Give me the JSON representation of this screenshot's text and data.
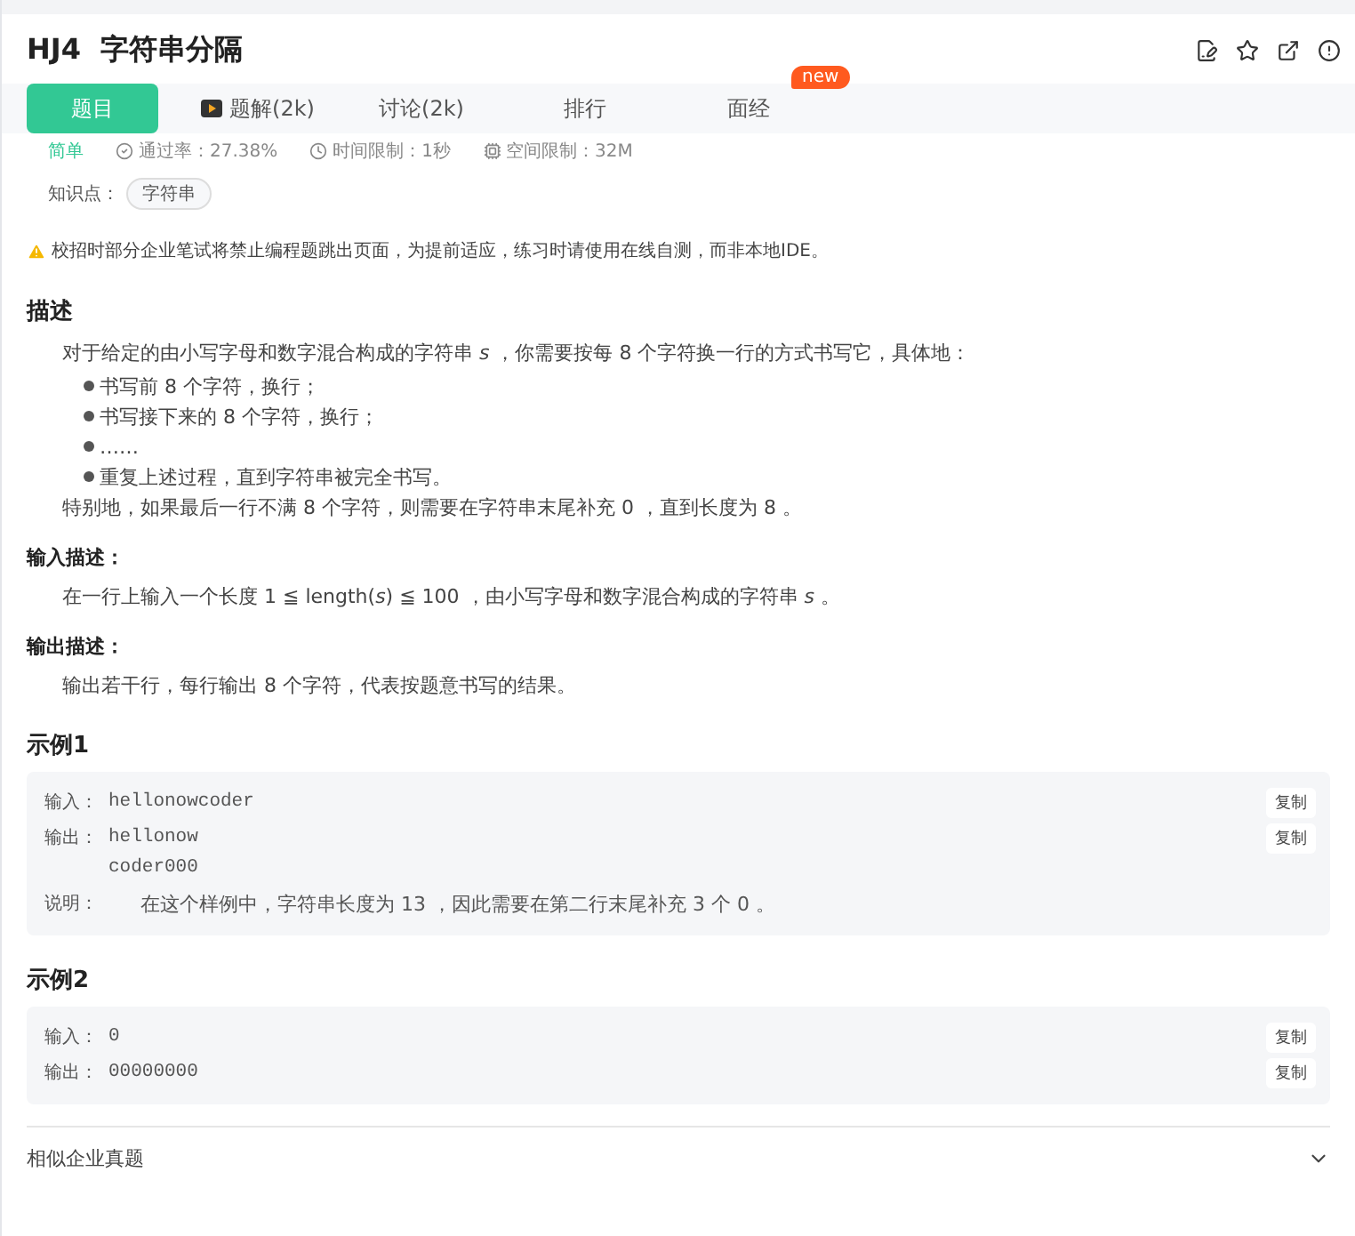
{
  "title": "HJ4  字符串分隔",
  "tabs": [
    {
      "label": "题目",
      "selected": true,
      "kind": "plain"
    },
    {
      "label": "题解(2k)",
      "selected": false,
      "kind": "video"
    },
    {
      "label": "讨论(2k)",
      "selected": false,
      "kind": "plain"
    },
    {
      "label": "排行",
      "selected": false,
      "kind": "plain"
    },
    {
      "label": "面经",
      "selected": false,
      "kind": "plain",
      "badge": "new"
    }
  ],
  "stats": {
    "difficulty": "简单",
    "pass_rate": "通过率：27.38%",
    "time_limit": "时间限制：1秒",
    "memory_limit": "空间限制：32M"
  },
  "knowledge": {
    "label": "知识点：",
    "tags": [
      "字符串"
    ]
  },
  "notice": "校招时部分企业笔试将禁止编程题跳出页面，为提前适应，练习时请使用在线自测，而非本地IDE。",
  "description": {
    "heading": "描述",
    "intro": "对于给定的由小写字母和数字混合构成的字符串 *s* ，你需要按每 8 个字符换一行的方式书写它，具体地：",
    "bullets": [
      "书写前 8 个字符，换行；",
      "书写接下来的 8 个字符，换行；",
      "……",
      "重复上述过程，直到字符串被完全书写。"
    ],
    "note": "特别地，如果最后一行不满 8 个字符，则需要在字符串末尾补充 0 ，直到长度为 8 。"
  },
  "input_desc": {
    "heading": "输入描述：",
    "text": "在一行上输入一个长度 1 ≦ length(*s*) ≦ 100 ，由小写字母和数字混合构成的字符串 *s* 。"
  },
  "output_desc": {
    "heading": "输出描述：",
    "text": "输出若干行，每行输出 8 个字符，代表按题意书写的结果。"
  },
  "examples": [
    {
      "heading": "示例1",
      "input_label": "输入：",
      "input": [
        "hellonowcoder"
      ],
      "output_label": "输出：",
      "output": [
        "hellonow",
        "coder000"
      ],
      "input_copy": "复制",
      "output_copy": "复制",
      "explain_label": "说明：",
      "explain": "在这个样例中，字符串长度为 13 ，因此需要在第二行末尾补充 3 个 0 。"
    },
    {
      "heading": "示例2",
      "input_label": "输入：",
      "input": [
        "0"
      ],
      "output_label": "输出：",
      "output": [
        "00000000"
      ],
      "input_copy": "复制",
      "output_copy": "复制"
    }
  ],
  "similar": {
    "label": "相似企业真题"
  }
}
